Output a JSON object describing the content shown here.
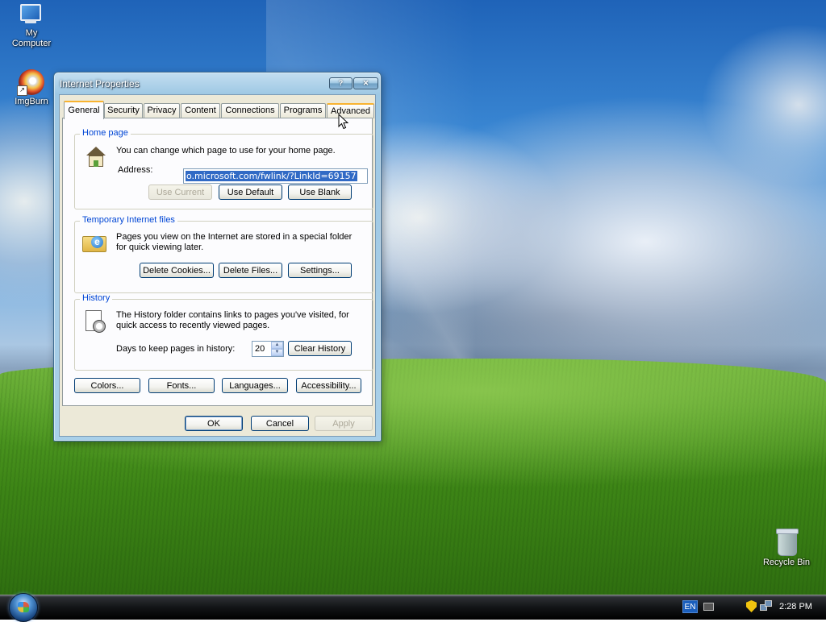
{
  "desktop": {
    "icons": [
      {
        "label_line1": "My",
        "label_line2": "Computer",
        "icon": "my-computer-icon"
      },
      {
        "label": "ImgBurn",
        "icon": "imgburn-icon"
      },
      {
        "label": "Recycle Bin",
        "icon": "recycle-bin-icon"
      }
    ]
  },
  "dialog": {
    "title": "Internet Properties",
    "title_buttons": {
      "help": "?",
      "close": "✕"
    },
    "tabs": [
      {
        "label": "General",
        "active": true
      },
      {
        "label": "Security"
      },
      {
        "label": "Privacy"
      },
      {
        "label": "Content"
      },
      {
        "label": "Connections"
      },
      {
        "label": "Programs"
      },
      {
        "label": "Advanced",
        "hovered": true
      }
    ],
    "home_page": {
      "title": "Home page",
      "icon": "home-page-icon",
      "description": "You can change which page to use for your home page.",
      "address_label": "Address:",
      "address_value": "o.microsoft.com/fwlink/?LinkId=69157",
      "buttons": {
        "use_current": "Use Current",
        "use_default": "Use Default",
        "use_blank": "Use Blank"
      }
    },
    "temp_files": {
      "title": "Temporary Internet files",
      "icon": "ie-folder-icon",
      "description_line1": "Pages you view on the Internet are stored in a special folder",
      "description_line2": "for quick viewing later.",
      "buttons": {
        "delete_cookies": "Delete Cookies...",
        "delete_files": "Delete Files...",
        "settings": "Settings..."
      }
    },
    "history": {
      "title": "History",
      "icon": "history-clock-icon",
      "description_line1": "The History folder contains links to pages you've visited, for",
      "description_line2": "quick access to recently viewed pages.",
      "days_label": "Days to keep pages in history:",
      "days_value": "20",
      "clear_button": "Clear History"
    },
    "bottom_buttons": {
      "colors": "Colors...",
      "fonts": "Fonts...",
      "languages": "Languages...",
      "accessibility": "Accessibility..."
    },
    "footer_buttons": {
      "ok": "OK",
      "cancel": "Cancel",
      "apply": "Apply"
    }
  },
  "taskbar": {
    "language": "EN",
    "clock": "2:28 PM"
  }
}
